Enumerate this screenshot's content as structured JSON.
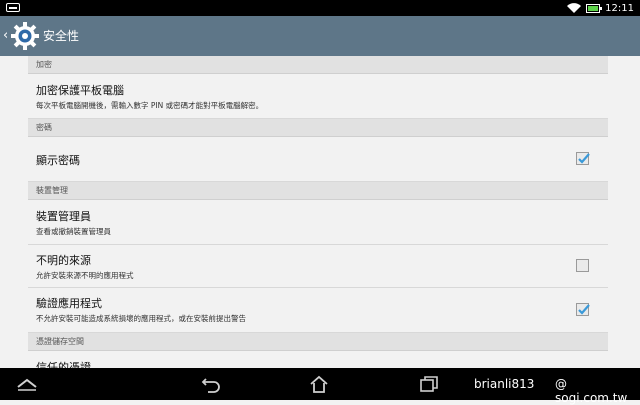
{
  "status_bar": {
    "time": "12:11",
    "icons": [
      "notification-icon",
      "wifi-icon",
      "battery-icon"
    ]
  },
  "action_bar": {
    "title": "安全性",
    "icon": "settings-gear-icon",
    "accent": "#5e7688"
  },
  "sections": [
    {
      "header": "加密",
      "items": [
        {
          "title": "加密保護平板電腦",
          "summary": "每次平板電腦開機後，需輸入數字 PIN 或密碼才能對平板電腦解密。"
        }
      ]
    },
    {
      "header": "密碼",
      "items": [
        {
          "title": "顯示密碼",
          "checked": true
        }
      ]
    },
    {
      "header": "裝置管理",
      "items": [
        {
          "title": "裝置管理員",
          "summary": "查看或撤銷裝置管理員"
        },
        {
          "title": "不明的來源",
          "summary": "允許安裝來源不明的應用程式",
          "checked": false
        },
        {
          "title": "驗證應用程式",
          "summary": "不允許安裝可能造成系統損壞的應用程式，或在安裝前提出警告",
          "checked": true
        }
      ]
    },
    {
      "header": "憑證儲存空間",
      "items": [
        {
          "title": "信任的憑證"
        }
      ]
    }
  ],
  "nav_bar": {
    "icons": [
      "menu-chevron-icon",
      "back-icon",
      "home-icon",
      "recents-icon"
    ]
  },
  "watermark": {
    "user": "brianli813",
    "site": "@ sogi.com.tw"
  }
}
